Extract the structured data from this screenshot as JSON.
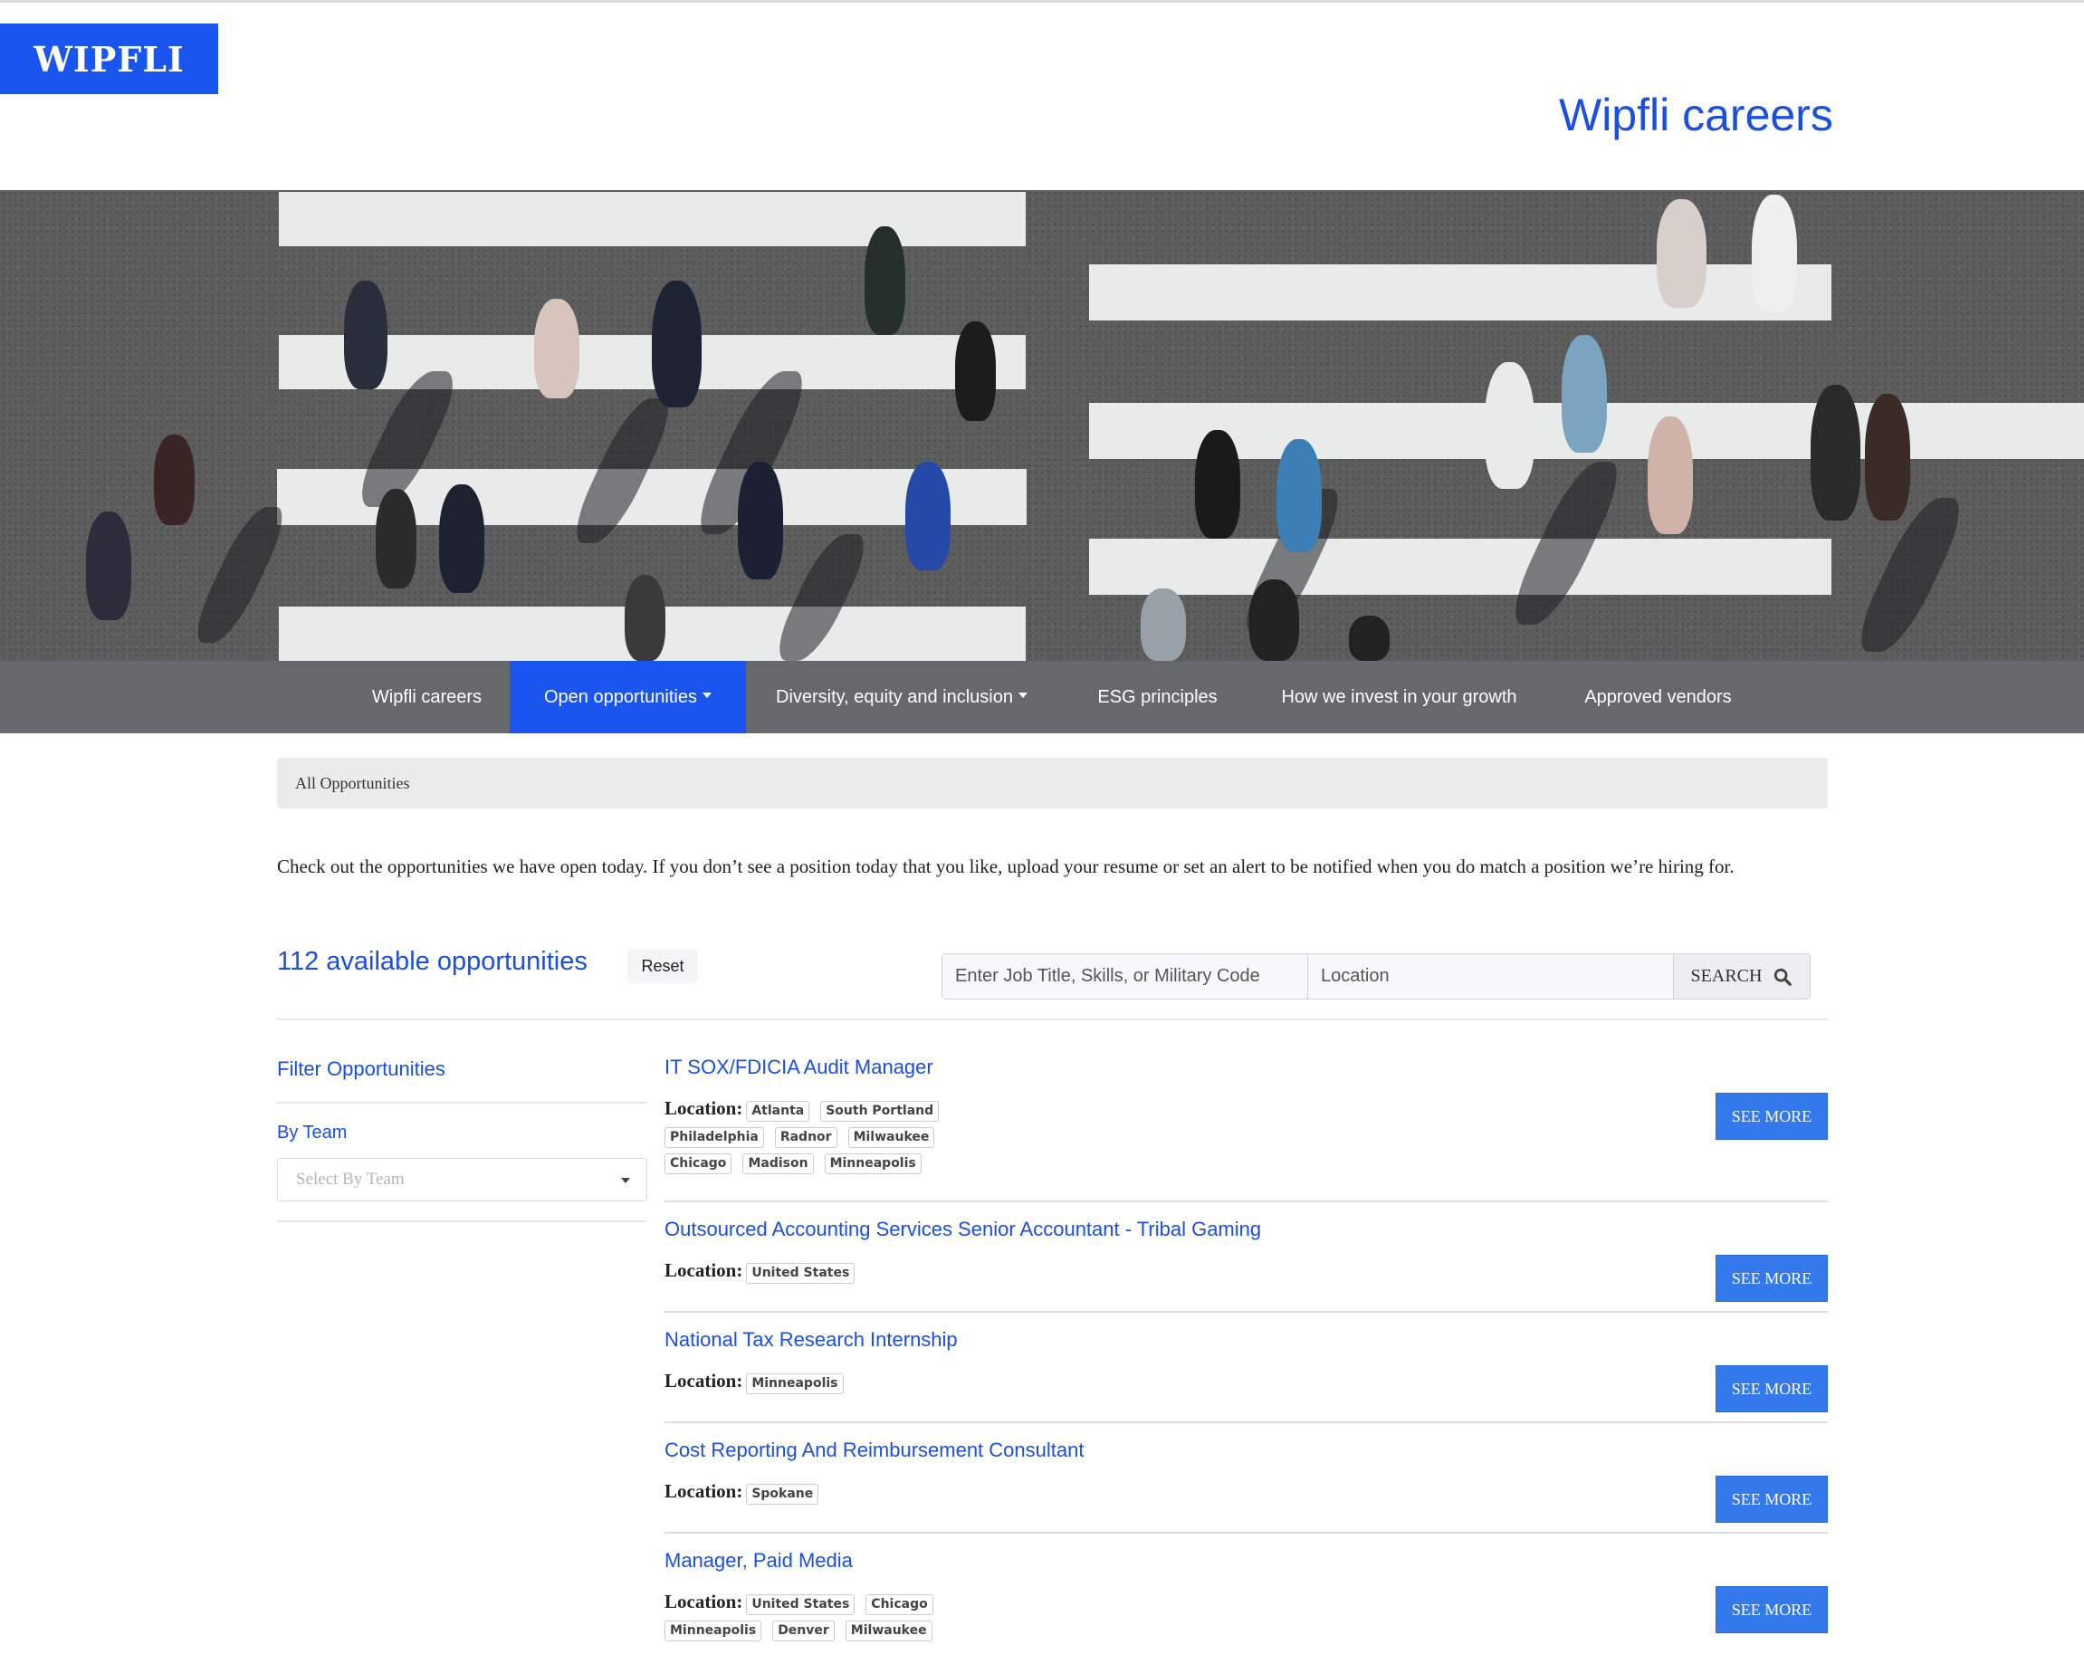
{
  "header": {
    "logo_text": "WIPFLI",
    "site_title": "Wipfli careers"
  },
  "hero": {
    "image_description": "aerial view of pedestrians on a crosswalk"
  },
  "nav": {
    "items": [
      {
        "label": "Wipfli careers",
        "dropdown": false,
        "active": false
      },
      {
        "label": "Open opportunities",
        "dropdown": true,
        "active": true
      },
      {
        "label": "Diversity, equity and inclusion",
        "dropdown": true,
        "active": false
      },
      {
        "label": "ESG principles",
        "dropdown": false,
        "active": false
      },
      {
        "label": "How we invest in your growth",
        "dropdown": false,
        "active": false
      },
      {
        "label": "Approved vendors",
        "dropdown": false,
        "active": false
      }
    ]
  },
  "breadcrumb": "All Opportunities",
  "intro": "Check out the opportunities we have open today. If you don’t see a position today that you like, upload your resume or set an alert to be notified when you do match a position we’re hiring for.",
  "results": {
    "count_label": "112 available opportunities",
    "reset_label": "Reset"
  },
  "search": {
    "keyword_placeholder": "Enter Job Title, Skills, or Military Code",
    "location_placeholder": "Location",
    "button_label": "SEARCH"
  },
  "filters": {
    "title": "Filter Opportunities",
    "by_team_label": "By Team",
    "team_select_placeholder": "Select By Team"
  },
  "jobs": {
    "location_label": "Location:",
    "see_more_label": "SEE MORE",
    "items": [
      {
        "title": "IT SOX/FDICIA Audit Manager",
        "locations": [
          "Atlanta",
          "South Portland",
          "Philadelphia",
          "Radnor",
          "Milwaukee",
          "Chicago",
          "Madison",
          "Minneapolis"
        ]
      },
      {
        "title": "Outsourced Accounting Services Senior Accountant - Tribal Gaming",
        "locations": [
          "United States"
        ]
      },
      {
        "title": "National Tax Research Internship",
        "locations": [
          "Minneapolis"
        ]
      },
      {
        "title": "Cost Reporting And Reimbursement Consultant",
        "locations": [
          "Spokane"
        ]
      },
      {
        "title": "Manager, Paid Media",
        "locations": [
          "United States",
          "Chicago",
          "Minneapolis",
          "Denver",
          "Milwaukee"
        ]
      }
    ]
  },
  "colors": {
    "brand_blue": "#1a55f0",
    "link_blue": "#1a4fe0",
    "button_blue": "#3479ec",
    "nav_gray": "#67686b"
  }
}
